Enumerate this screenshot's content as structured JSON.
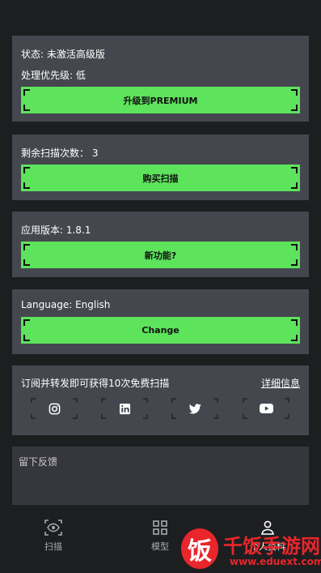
{
  "status_card": {
    "status_text": "状态: 未激活高级版",
    "priority_text": "处理优先级: 低",
    "upgrade_label": "升级到PREMIUM"
  },
  "scans_card": {
    "remaining_text": "剩余扫描次数： 3",
    "buy_label": "购买扫描"
  },
  "version_card": {
    "version_text": "应用版本: 1.8.1",
    "whats_new_label": "新功能?"
  },
  "language_card": {
    "language_text": "Language:  English",
    "change_label": "Change"
  },
  "subscribe_card": {
    "promo_text": "订阅并转发即可获得10次免费扫描",
    "details_label": "详细信息",
    "socials": [
      "instagram-icon",
      "linkedin-icon",
      "twitter-icon",
      "youtube-icon"
    ]
  },
  "feedback": {
    "placeholder": "留下反馈"
  },
  "tabbar": {
    "tabs": [
      {
        "label": "扫描",
        "icon": "eye-scan-icon"
      },
      {
        "label": "模型",
        "icon": "grid-icon"
      },
      {
        "label": "个人资料",
        "icon": "person-icon"
      }
    ]
  },
  "watermark": {
    "logo_char": "饭",
    "title": "千饭手游网",
    "url": "www.eduext.com"
  },
  "colors": {
    "background": "#1d1e20",
    "card": "#45474e",
    "accent": "#5de35c",
    "watermark_red": "#e8262b"
  }
}
